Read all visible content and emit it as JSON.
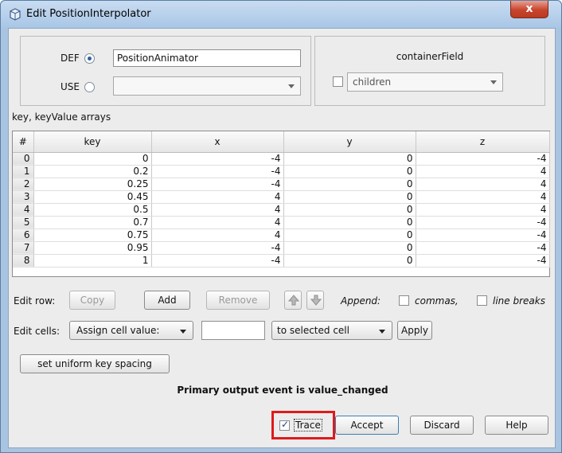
{
  "window": {
    "title": "Edit PositionInterpolator",
    "close_label": "x"
  },
  "def_use": {
    "def_label": "DEF",
    "def_value": "PositionAnimator",
    "use_label": "USE",
    "use_value": ""
  },
  "container_field": {
    "title": "containerField",
    "value": "children",
    "checked": false
  },
  "table": {
    "section_label": "key, keyValue arrays",
    "columns": [
      "#",
      "key",
      "x",
      "y",
      "z"
    ],
    "rows": [
      [
        "0",
        "0",
        "-4",
        "0",
        "-4"
      ],
      [
        "1",
        "0.2",
        "-4",
        "0",
        "4"
      ],
      [
        "2",
        "0.25",
        "-4",
        "0",
        "4"
      ],
      [
        "3",
        "0.45",
        "4",
        "0",
        "4"
      ],
      [
        "4",
        "0.5",
        "4",
        "0",
        "4"
      ],
      [
        "5",
        "0.7",
        "4",
        "0",
        "-4"
      ],
      [
        "6",
        "0.75",
        "4",
        "0",
        "-4"
      ],
      [
        "7",
        "0.95",
        "-4",
        "0",
        "-4"
      ],
      [
        "8",
        "1",
        "-4",
        "0",
        "-4"
      ]
    ]
  },
  "edit_row": {
    "label": "Edit row:",
    "copy": "Copy",
    "add": "Add",
    "remove": "Remove",
    "append_label": "Append:",
    "commas": "commas,",
    "line_breaks": "line breaks"
  },
  "edit_cells": {
    "label": "Edit cells:",
    "assign": "Assign cell value:",
    "value": "",
    "target": "to selected cell",
    "apply": "Apply"
  },
  "uniform_button": "set uniform key spacing",
  "status": "Primary output event is value_changed",
  "footer": {
    "trace": "Trace",
    "trace_checked": true,
    "accept": "Accept",
    "discard": "Discard",
    "help": "Help"
  },
  "colors": {
    "accent": "#2b5fa3",
    "highlight": "#e0191b",
    "title_bar": "#a8c6e6"
  }
}
